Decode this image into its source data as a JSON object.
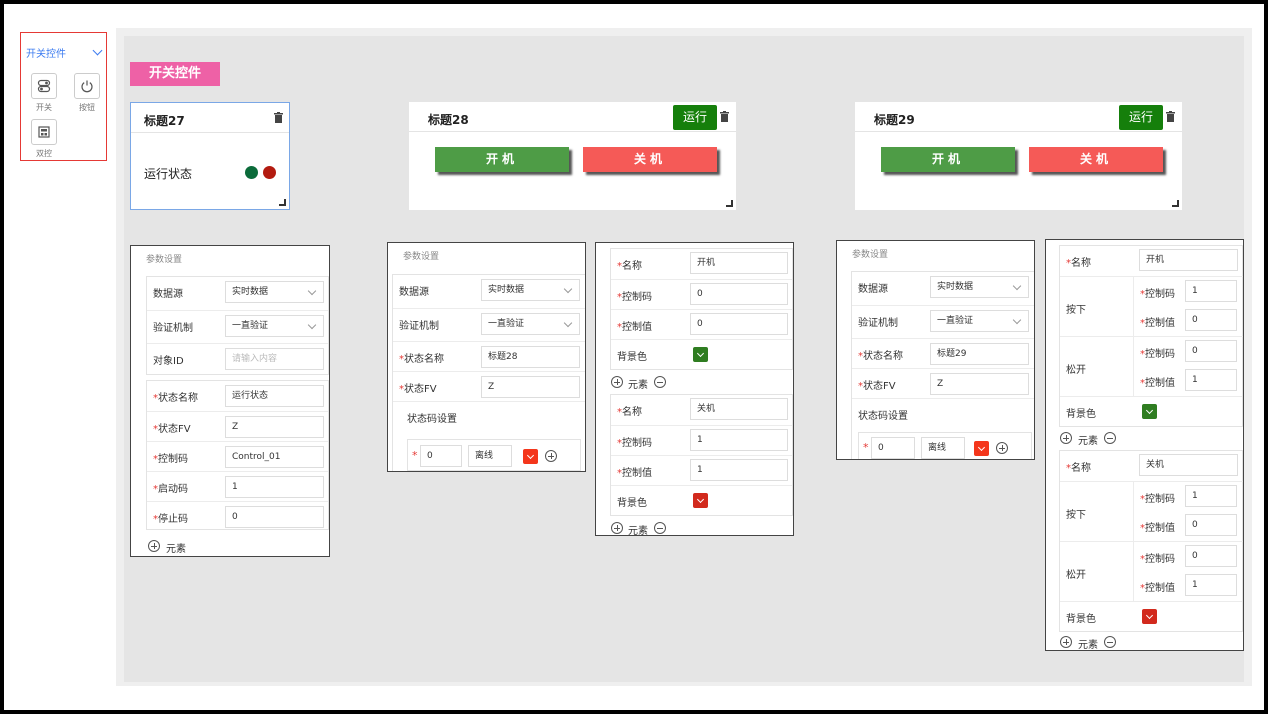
{
  "palette": {
    "title": "开关控件",
    "items": [
      {
        "label": "开关",
        "icon": "toggle-icon"
      },
      {
        "label": "按钮",
        "icon": "power-icon"
      },
      {
        "label": "双控",
        "icon": "dual-control-icon"
      }
    ]
  },
  "section_tag": "开关控件",
  "widgets": [
    {
      "title": "标题27",
      "status_label": "运行状态",
      "colors": {
        "on": "#0b6b3a",
        "off": "#b31b10"
      }
    },
    {
      "title": "标题28",
      "run_label": "运行",
      "on_label": "开机",
      "off_label": "关机"
    },
    {
      "title": "标题29",
      "run_label": "运行",
      "on_label": "开机",
      "off_label": "关机"
    }
  ],
  "colors": {
    "run": "#157f0b",
    "on_btn": "#4e9c46",
    "off_btn": "#f55a57",
    "red_swatch": "#d22a1d",
    "green_swatch": "#2f7d21",
    "offline_swatch": "#f4361b",
    "tag": "#ee61a6"
  },
  "form1": {
    "header": "参数设置",
    "rows": [
      {
        "label": "数据源",
        "value": "实时数据"
      },
      {
        "label": "验证机制",
        "value": "一直验证"
      },
      {
        "label": "对象ID",
        "placeholder": "请输入内容"
      }
    ],
    "rows2": [
      {
        "label": "状态名称",
        "value": "运行状态"
      },
      {
        "label": "状态FV",
        "value": "Z"
      },
      {
        "label": "控制码",
        "value": "Control_01"
      },
      {
        "label": "启动码",
        "value": "1"
      },
      {
        "label": "停止码",
        "value": "0"
      }
    ],
    "add_label": "元素"
  },
  "form2": {
    "header": "参数设置",
    "rows": [
      {
        "label": "数据源",
        "value": "实时数据"
      },
      {
        "label": "验证机制",
        "value": "一直验证"
      },
      {
        "label": "状态名称",
        "value": "标题28"
      },
      {
        "label": "状态FV",
        "value": "Z"
      }
    ],
    "code_section": "状态码设置",
    "code_value": "0",
    "code_text": "离线"
  },
  "form2b": {
    "groups": [
      {
        "name_label": "名称",
        "name": "开机",
        "code_label": "控制码",
        "code": "0",
        "val_label": "控制值",
        "val": "0",
        "bg_label": "背景色"
      },
      {
        "name_label": "名称",
        "name": "关机",
        "code_label": "控制码",
        "code": "1",
        "val_label": "控制值",
        "val": "1",
        "bg_label": "背景色"
      }
    ],
    "add_label": "元素"
  },
  "form3": {
    "header": "参数设置",
    "rows": [
      {
        "label": "数据源",
        "value": "实时数据"
      },
      {
        "label": "验证机制",
        "value": "一直验证"
      },
      {
        "label": "状态名称",
        "value": "标题29"
      },
      {
        "label": "状态FV",
        "value": "Z"
      }
    ],
    "code_section": "状态码设置",
    "code_value": "0",
    "code_text": "离线"
  },
  "form3b": {
    "groups": [
      {
        "name_label": "名称",
        "name": "开机",
        "press_label": "按下",
        "press_code": "1",
        "press_val": "0",
        "release_label": "松开",
        "release_code": "0",
        "release_val": "1",
        "bg_label": "背景色"
      },
      {
        "name_label": "名称",
        "name": "关机",
        "press_label": "按下",
        "press_code": "1",
        "press_val": "0",
        "release_label": "松开",
        "release_code": "0",
        "release_val": "1",
        "bg_label": "背景色"
      }
    ],
    "code_label": "控制码",
    "val_label": "控制值",
    "add_label": "元素"
  }
}
